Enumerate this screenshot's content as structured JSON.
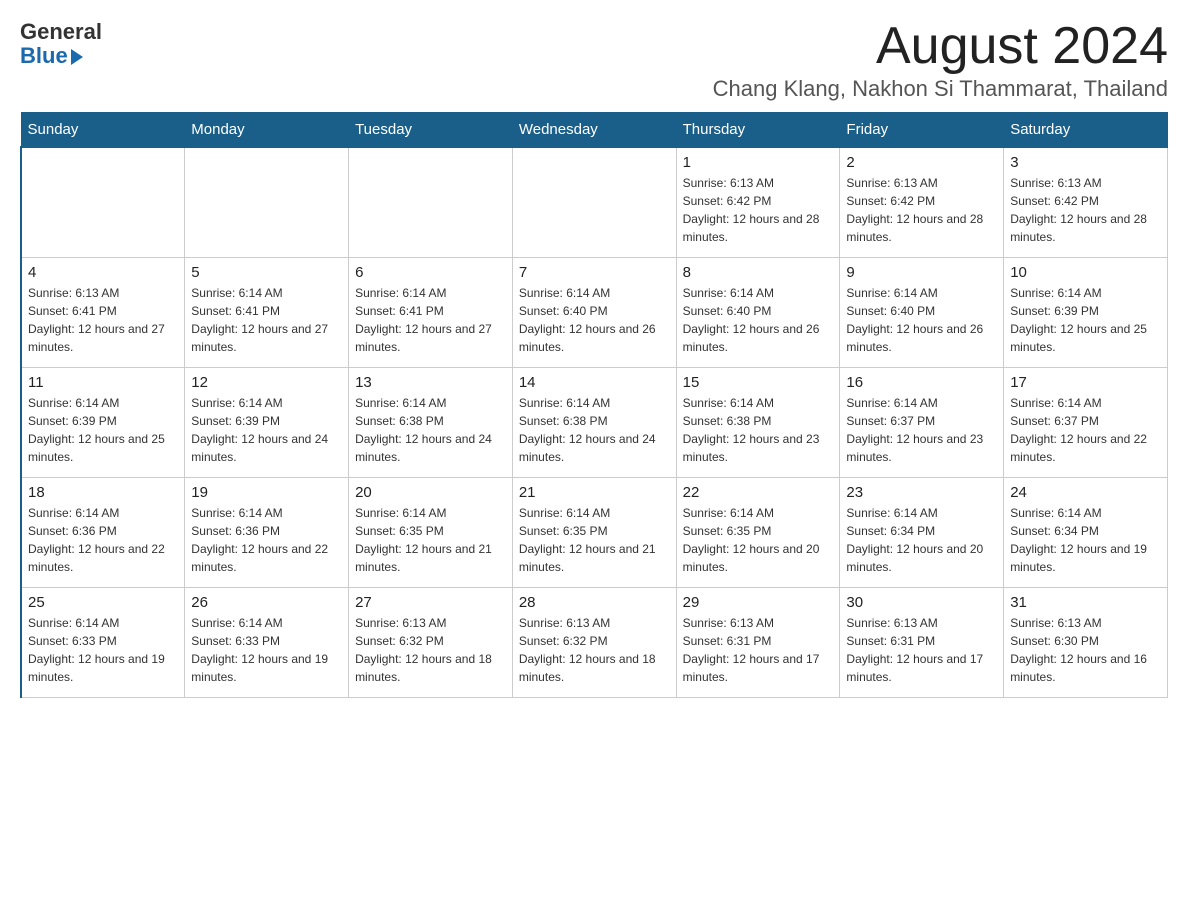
{
  "logo": {
    "line1": "General",
    "line2": "Blue"
  },
  "header": {
    "month": "August 2024",
    "location": "Chang Klang, Nakhon Si Thammarat, Thailand"
  },
  "days_of_week": [
    "Sunday",
    "Monday",
    "Tuesday",
    "Wednesday",
    "Thursday",
    "Friday",
    "Saturday"
  ],
  "weeks": [
    [
      {
        "day": "",
        "sunrise": "",
        "sunset": "",
        "daylight": ""
      },
      {
        "day": "",
        "sunrise": "",
        "sunset": "",
        "daylight": ""
      },
      {
        "day": "",
        "sunrise": "",
        "sunset": "",
        "daylight": ""
      },
      {
        "day": "",
        "sunrise": "",
        "sunset": "",
        "daylight": ""
      },
      {
        "day": "1",
        "sunrise": "Sunrise: 6:13 AM",
        "sunset": "Sunset: 6:42 PM",
        "daylight": "Daylight: 12 hours and 28 minutes."
      },
      {
        "day": "2",
        "sunrise": "Sunrise: 6:13 AM",
        "sunset": "Sunset: 6:42 PM",
        "daylight": "Daylight: 12 hours and 28 minutes."
      },
      {
        "day": "3",
        "sunrise": "Sunrise: 6:13 AM",
        "sunset": "Sunset: 6:42 PM",
        "daylight": "Daylight: 12 hours and 28 minutes."
      }
    ],
    [
      {
        "day": "4",
        "sunrise": "Sunrise: 6:13 AM",
        "sunset": "Sunset: 6:41 PM",
        "daylight": "Daylight: 12 hours and 27 minutes."
      },
      {
        "day": "5",
        "sunrise": "Sunrise: 6:14 AM",
        "sunset": "Sunset: 6:41 PM",
        "daylight": "Daylight: 12 hours and 27 minutes."
      },
      {
        "day": "6",
        "sunrise": "Sunrise: 6:14 AM",
        "sunset": "Sunset: 6:41 PM",
        "daylight": "Daylight: 12 hours and 27 minutes."
      },
      {
        "day": "7",
        "sunrise": "Sunrise: 6:14 AM",
        "sunset": "Sunset: 6:40 PM",
        "daylight": "Daylight: 12 hours and 26 minutes."
      },
      {
        "day": "8",
        "sunrise": "Sunrise: 6:14 AM",
        "sunset": "Sunset: 6:40 PM",
        "daylight": "Daylight: 12 hours and 26 minutes."
      },
      {
        "day": "9",
        "sunrise": "Sunrise: 6:14 AM",
        "sunset": "Sunset: 6:40 PM",
        "daylight": "Daylight: 12 hours and 26 minutes."
      },
      {
        "day": "10",
        "sunrise": "Sunrise: 6:14 AM",
        "sunset": "Sunset: 6:39 PM",
        "daylight": "Daylight: 12 hours and 25 minutes."
      }
    ],
    [
      {
        "day": "11",
        "sunrise": "Sunrise: 6:14 AM",
        "sunset": "Sunset: 6:39 PM",
        "daylight": "Daylight: 12 hours and 25 minutes."
      },
      {
        "day": "12",
        "sunrise": "Sunrise: 6:14 AM",
        "sunset": "Sunset: 6:39 PM",
        "daylight": "Daylight: 12 hours and 24 minutes."
      },
      {
        "day": "13",
        "sunrise": "Sunrise: 6:14 AM",
        "sunset": "Sunset: 6:38 PM",
        "daylight": "Daylight: 12 hours and 24 minutes."
      },
      {
        "day": "14",
        "sunrise": "Sunrise: 6:14 AM",
        "sunset": "Sunset: 6:38 PM",
        "daylight": "Daylight: 12 hours and 24 minutes."
      },
      {
        "day": "15",
        "sunrise": "Sunrise: 6:14 AM",
        "sunset": "Sunset: 6:38 PM",
        "daylight": "Daylight: 12 hours and 23 minutes."
      },
      {
        "day": "16",
        "sunrise": "Sunrise: 6:14 AM",
        "sunset": "Sunset: 6:37 PM",
        "daylight": "Daylight: 12 hours and 23 minutes."
      },
      {
        "day": "17",
        "sunrise": "Sunrise: 6:14 AM",
        "sunset": "Sunset: 6:37 PM",
        "daylight": "Daylight: 12 hours and 22 minutes."
      }
    ],
    [
      {
        "day": "18",
        "sunrise": "Sunrise: 6:14 AM",
        "sunset": "Sunset: 6:36 PM",
        "daylight": "Daylight: 12 hours and 22 minutes."
      },
      {
        "day": "19",
        "sunrise": "Sunrise: 6:14 AM",
        "sunset": "Sunset: 6:36 PM",
        "daylight": "Daylight: 12 hours and 22 minutes."
      },
      {
        "day": "20",
        "sunrise": "Sunrise: 6:14 AM",
        "sunset": "Sunset: 6:35 PM",
        "daylight": "Daylight: 12 hours and 21 minutes."
      },
      {
        "day": "21",
        "sunrise": "Sunrise: 6:14 AM",
        "sunset": "Sunset: 6:35 PM",
        "daylight": "Daylight: 12 hours and 21 minutes."
      },
      {
        "day": "22",
        "sunrise": "Sunrise: 6:14 AM",
        "sunset": "Sunset: 6:35 PM",
        "daylight": "Daylight: 12 hours and 20 minutes."
      },
      {
        "day": "23",
        "sunrise": "Sunrise: 6:14 AM",
        "sunset": "Sunset: 6:34 PM",
        "daylight": "Daylight: 12 hours and 20 minutes."
      },
      {
        "day": "24",
        "sunrise": "Sunrise: 6:14 AM",
        "sunset": "Sunset: 6:34 PM",
        "daylight": "Daylight: 12 hours and 19 minutes."
      }
    ],
    [
      {
        "day": "25",
        "sunrise": "Sunrise: 6:14 AM",
        "sunset": "Sunset: 6:33 PM",
        "daylight": "Daylight: 12 hours and 19 minutes."
      },
      {
        "day": "26",
        "sunrise": "Sunrise: 6:14 AM",
        "sunset": "Sunset: 6:33 PM",
        "daylight": "Daylight: 12 hours and 19 minutes."
      },
      {
        "day": "27",
        "sunrise": "Sunrise: 6:13 AM",
        "sunset": "Sunset: 6:32 PM",
        "daylight": "Daylight: 12 hours and 18 minutes."
      },
      {
        "day": "28",
        "sunrise": "Sunrise: 6:13 AM",
        "sunset": "Sunset: 6:32 PM",
        "daylight": "Daylight: 12 hours and 18 minutes."
      },
      {
        "day": "29",
        "sunrise": "Sunrise: 6:13 AM",
        "sunset": "Sunset: 6:31 PM",
        "daylight": "Daylight: 12 hours and 17 minutes."
      },
      {
        "day": "30",
        "sunrise": "Sunrise: 6:13 AM",
        "sunset": "Sunset: 6:31 PM",
        "daylight": "Daylight: 12 hours and 17 minutes."
      },
      {
        "day": "31",
        "sunrise": "Sunrise: 6:13 AM",
        "sunset": "Sunset: 6:30 PM",
        "daylight": "Daylight: 12 hours and 16 minutes."
      }
    ]
  ]
}
